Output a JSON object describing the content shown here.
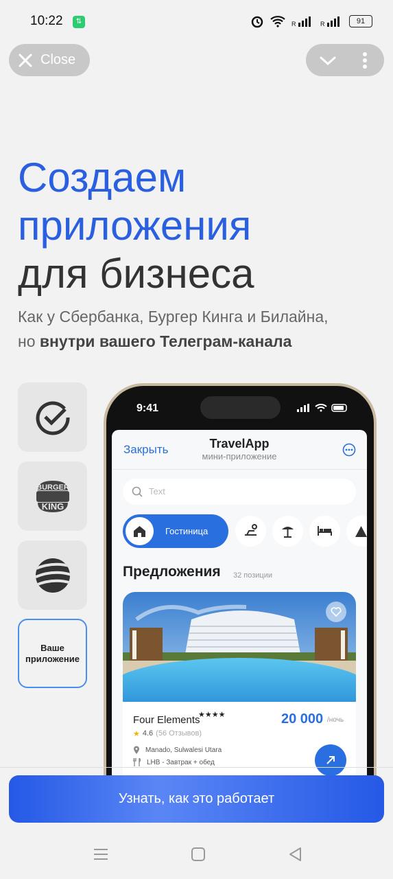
{
  "status": {
    "time": "10:22",
    "badge": "⇅",
    "battery": "91"
  },
  "top": {
    "close_label": "Close"
  },
  "hero": {
    "line1": "Создаем",
    "line2": "приложения",
    "line3": "для бизнеса",
    "sub1": "Как у Сбербанка, Бургер Кинга и Билайна,",
    "sub2_prefix": "но ",
    "sub2_bold": "внутри вашего Телеграм-канала"
  },
  "tiles": {
    "custom_label": "Ваше приложение",
    "burger_text_1": "BURGER",
    "burger_text_2": "KING"
  },
  "phone": {
    "time": "9:41",
    "close": "Закрыть",
    "app_title": "TravelApp",
    "app_sub": "мини-приложение",
    "search_placeholder": "Text",
    "chip_active": "Гостиница",
    "offers_title": "Предложения",
    "offers_count": "32 позиции",
    "card": {
      "name": "Four Elements",
      "stars": "★★★★",
      "price": "20 000",
      "per": "/ночь",
      "rating": "4.6",
      "reviews": "(56 Отзывов)",
      "location": "Manado, Sulwalesi Utara",
      "meal": "LHB - Завтрак + обед"
    }
  },
  "cta": {
    "label": "Узнать, как это работает"
  },
  "colors": {
    "accent": "#2a5fe0",
    "cta": "#2559e6"
  }
}
